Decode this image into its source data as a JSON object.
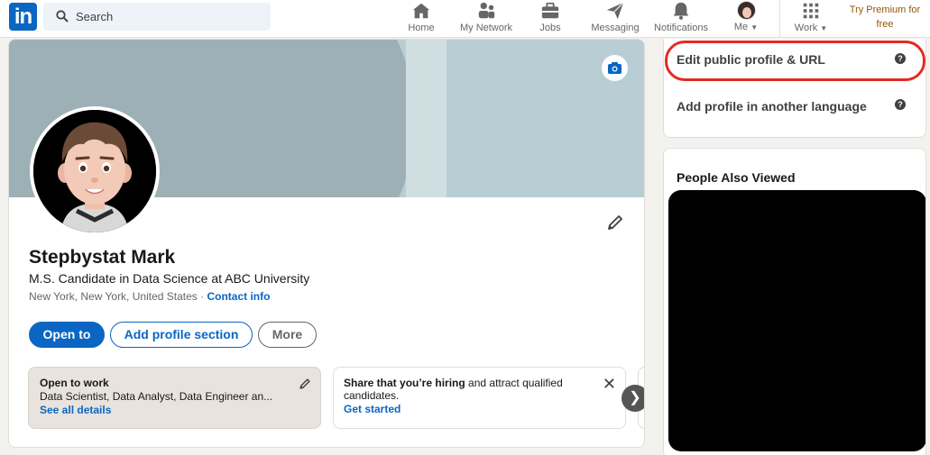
{
  "nav": {
    "search_placeholder": "Search",
    "items": [
      {
        "label": "Home",
        "icon": "home-icon"
      },
      {
        "label": "My Network",
        "icon": "network-icon"
      },
      {
        "label": "Jobs",
        "icon": "briefcase-icon"
      },
      {
        "label": "Messaging",
        "icon": "send-icon"
      },
      {
        "label": "Notifications",
        "icon": "bell-icon"
      },
      {
        "label": "Me",
        "icon": "avatar"
      },
      {
        "label": "Work",
        "icon": "grid-icon"
      }
    ],
    "premium": "Try Premium for free",
    "premium_color": "#915907"
  },
  "profile": {
    "name": "Stepbystat Mark",
    "headline": "M.S. Candidate in Data Science at ABC University",
    "location": "New York, New York, United States",
    "separator": "·",
    "contact": "Contact info",
    "buttons": {
      "open_to": "Open to",
      "add_section": "Add profile section",
      "more": "More"
    },
    "open_to_work": {
      "title": "Open to work",
      "roles": "Data Scientist, Data Analyst, Data Engineer an...",
      "link": "See all details"
    },
    "hiring": {
      "bold": "Share that you’re hiring",
      "rest": " and attract qualified candidates.",
      "link": "Get started"
    }
  },
  "sidebar": {
    "edit_public": "Edit public profile & URL",
    "add_language": "Add profile in another language",
    "people_also_viewed": "People Also Viewed"
  },
  "colors": {
    "accent": "#0a66c2",
    "highlight_ring": "#e32b23"
  }
}
